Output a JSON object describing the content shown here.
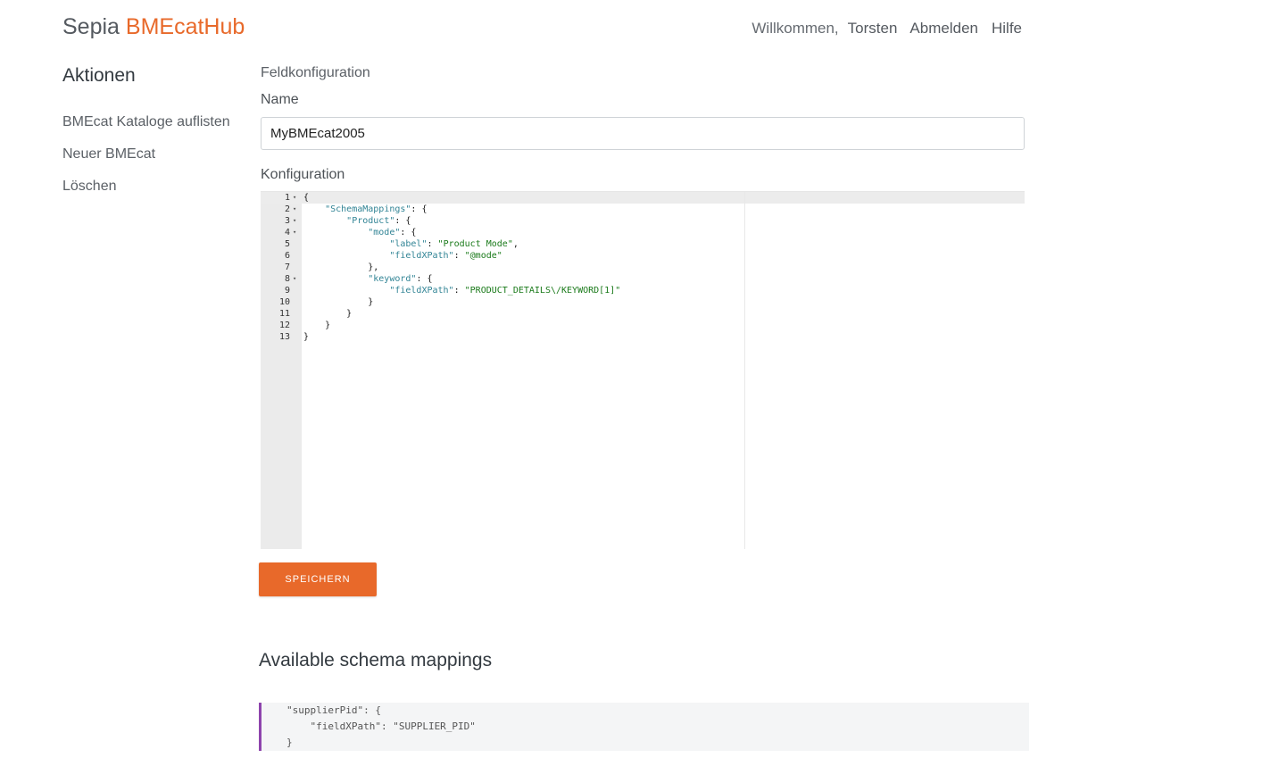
{
  "header": {
    "brand_part1": "Sepia",
    "brand_part2": "BMEcatHub",
    "welcome": "Willkommen,",
    "user": "Torsten",
    "logout": "Abmelden",
    "help": "Hilfe"
  },
  "sidebar": {
    "title": "Aktionen",
    "items": [
      {
        "label": "BMEcat Kataloge auflisten"
      },
      {
        "label": "Neuer BMEcat"
      },
      {
        "label": "Löschen"
      }
    ]
  },
  "main": {
    "section": "Feldkonfiguration",
    "name_label": "Name",
    "name_value": "MyBMEcat2005",
    "config_label": "Konfiguration",
    "editor_lines": [
      {
        "n": "1",
        "fold": "▾",
        "text": "{"
      },
      {
        "n": "2",
        "fold": "▾",
        "text": "    \"SchemaMappings\": {"
      },
      {
        "n": "3",
        "fold": "▾",
        "text": "        \"Product\": {"
      },
      {
        "n": "4",
        "fold": "▾",
        "text": "            \"mode\": {"
      },
      {
        "n": "5",
        "fold": "",
        "text": "                \"label\": \"Product Mode\","
      },
      {
        "n": "6",
        "fold": "",
        "text": "                \"fieldXPath\": \"@mode\""
      },
      {
        "n": "7",
        "fold": "",
        "text": "            },"
      },
      {
        "n": "8",
        "fold": "▾",
        "text": "            \"keyword\": {"
      },
      {
        "n": "9",
        "fold": "",
        "text": "                \"fieldXPath\": \"PRODUCT_DETAILS\\/KEYWORD[1]\""
      },
      {
        "n": "10",
        "fold": "",
        "text": "            }"
      },
      {
        "n": "11",
        "fold": "",
        "text": "        }"
      },
      {
        "n": "12",
        "fold": "",
        "text": "    }"
      },
      {
        "n": "13",
        "fold": "",
        "text": "}"
      }
    ],
    "save_label": "SPEICHERN"
  },
  "available": {
    "title": "Available schema mappings",
    "code_lines": [
      "\"supplierPid\": {",
      "    \"fieldXPath\": \"SUPPLIER_PID\"",
      "}"
    ]
  },
  "colors": {
    "accent": "#e8692a",
    "codeblock_border": "#8e44ad"
  }
}
